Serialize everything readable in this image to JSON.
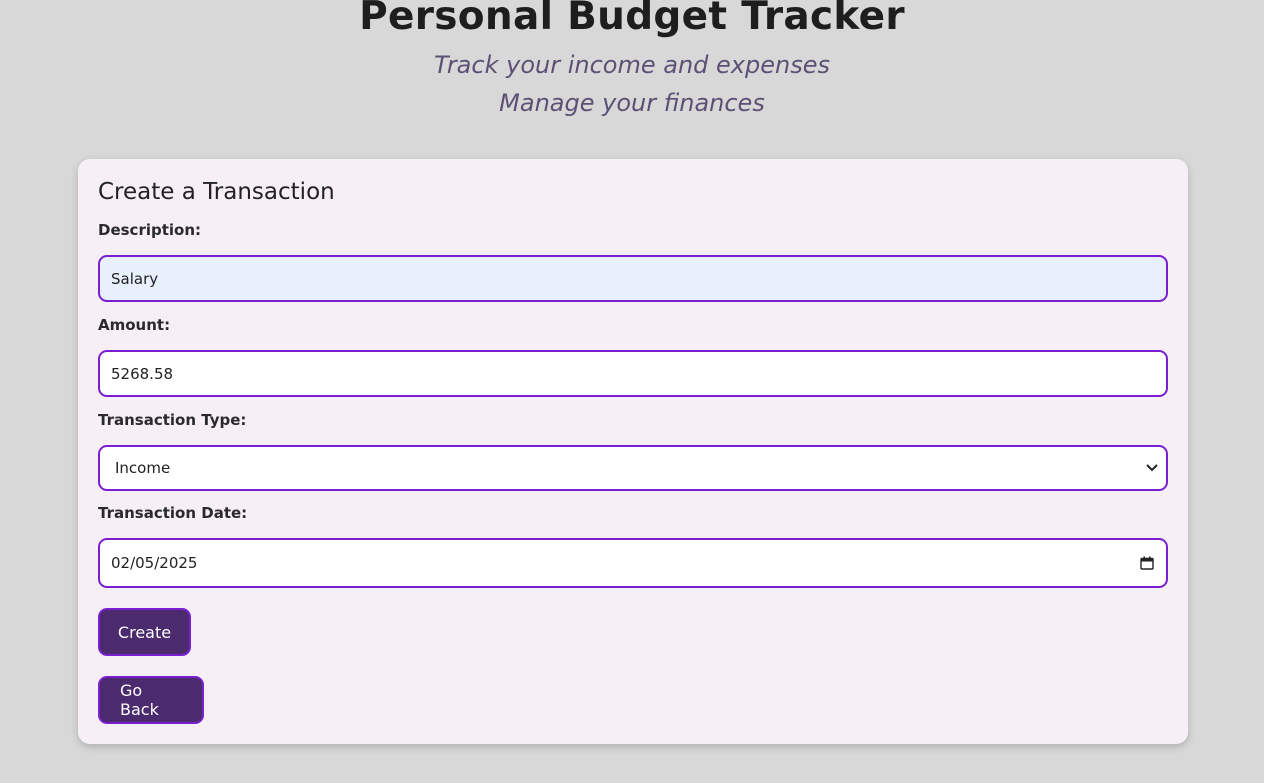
{
  "header": {
    "title": "Personal Budget Tracker",
    "subtitle_line1": "Track your income and expenses",
    "subtitle_line2": "Manage your finances"
  },
  "form": {
    "heading": "Create a Transaction",
    "description": {
      "label": "Description:",
      "value": "Salary"
    },
    "amount": {
      "label": "Amount:",
      "value": "5268.58"
    },
    "type": {
      "label": "Transaction Type:",
      "selected": "Income"
    },
    "date": {
      "label": "Transaction Date:",
      "value": "02/05/2025"
    },
    "create_label": "Create",
    "back_label": "Go Back"
  },
  "colors": {
    "background": "#d8d8d8",
    "card": "#f6eff6",
    "accent_border": "#7a1fcf",
    "button": "#4b2a6e",
    "subtitle": "#5c5075",
    "autofill": "#e8f0fe"
  },
  "icons": {
    "select": "chevron-down-icon",
    "date": "calendar-icon"
  }
}
